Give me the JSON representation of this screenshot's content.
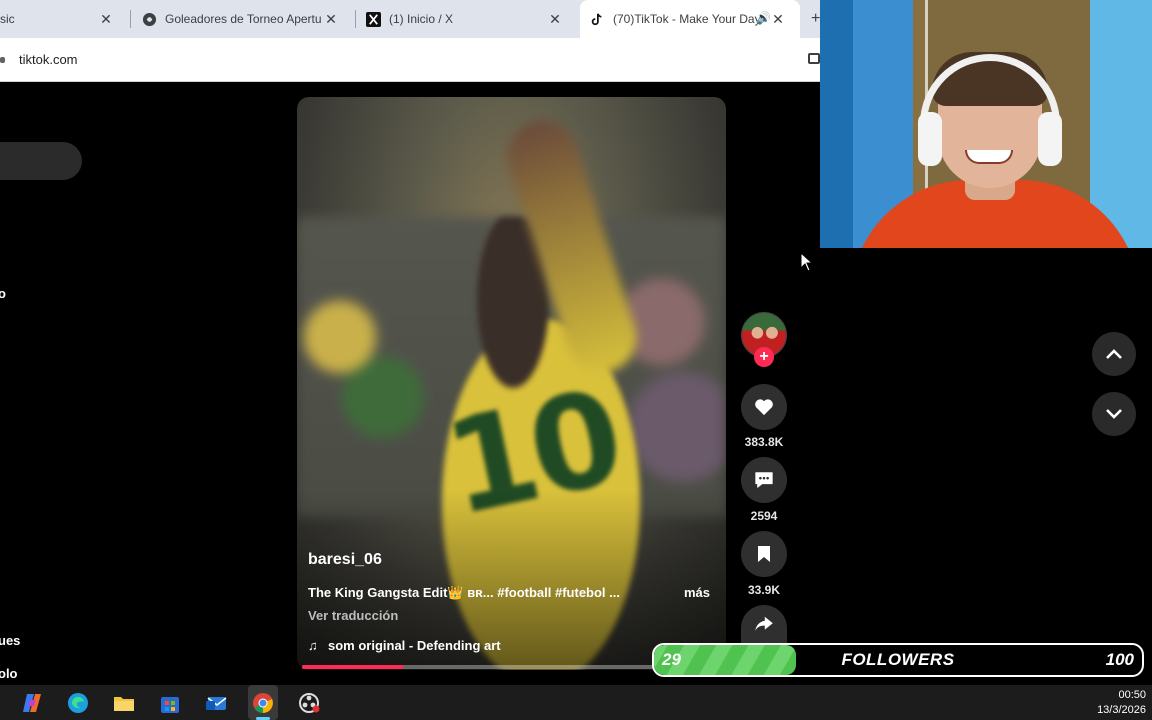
{
  "browser": {
    "tabs": [
      {
        "title": "sic",
        "icon": "music-icon"
      },
      {
        "title": "Goleadores de Torneo Apertura",
        "icon": "globe-icon"
      },
      {
        "title": "(1) Inicio / X",
        "icon": "x-logo-icon"
      },
      {
        "title": "(70)TikTok - Make Your Day",
        "icon": "tiktok-icon",
        "active": true
      }
    ],
    "url": "tiktok.com"
  },
  "sidebar": {
    "fragments": [
      "o",
      "ues",
      "olo"
    ]
  },
  "video": {
    "username": "baresi_06",
    "description": "The King Gangsta Edit👑 ʙʀ... #football #futebol ...",
    "more_label": "más",
    "translate_label": "Ver traducción",
    "music": "som original - Defending art",
    "progress_fraction": 0.28
  },
  "actions": {
    "likes": "383.8K",
    "comments": "2594",
    "saves": "33.9K"
  },
  "followers_goal": {
    "current": "29",
    "label": "FOLLOWERS",
    "goal": "100",
    "fill_fraction": 0.29,
    "fill_color": "#4fc24f"
  },
  "taskbar": {
    "time": "00:50",
    "date": "13/3/2026"
  },
  "colors": {
    "accent": "#fe2c55",
    "taskbar_highlight": "#60cdff"
  }
}
